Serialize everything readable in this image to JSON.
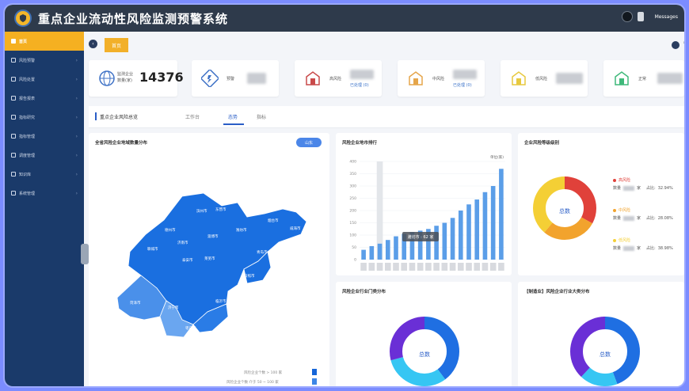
{
  "app": {
    "title": "重点企业流动性风险监测预警系统",
    "messages": "Messages"
  },
  "sidebar": {
    "items": [
      {
        "label": "首页",
        "active": true
      },
      {
        "label": "风险预警"
      },
      {
        "label": "风险处置"
      },
      {
        "label": "报告报表"
      },
      {
        "label": "指标研究"
      },
      {
        "label": "指标管理"
      },
      {
        "label": "调度管理"
      },
      {
        "label": "知识库"
      },
      {
        "label": "系统管理"
      }
    ]
  },
  "tabs": {
    "home_label": "首页"
  },
  "kpis": [
    {
      "label_line1": "监测企业",
      "label_line2": "数量(家)",
      "value": "14376",
      "icon": "globe-icon"
    },
    {
      "label": "预警",
      "icon": "warning-icon"
    },
    {
      "label": "高风险",
      "sub": "已处理 (0)",
      "icon": "house-red-icon",
      "color": "#c94a4a"
    },
    {
      "label": "中风险",
      "sub": "已处理 (0)",
      "icon": "house-orange-icon",
      "color": "#e5a54a"
    },
    {
      "label": "低风险",
      "icon": "house-yellow-icon",
      "color": "#e7c93e"
    },
    {
      "label": "正常",
      "icon": "house-green-icon",
      "color": "#3fb97a"
    }
  ],
  "section": {
    "title": "重点企业风险总览",
    "tabs": [
      "工作台",
      "态势",
      "指标"
    ]
  },
  "map_panel": {
    "title": "全省风险企业地域数量分布",
    "badge": "山东",
    "cities": [
      "聊城市",
      "德州市",
      "滨州市",
      "东营市",
      "烟台市",
      "威海市",
      "潍坊市",
      "淄博市",
      "济南市",
      "泰安市",
      "莱芜市",
      "青岛市",
      "日照市",
      "临沂市",
      "枣庄市",
      "济宁市",
      "菏泽市"
    ],
    "legend": [
      {
        "label": "风险企业个数 > 100 家",
        "color": "#1565d8"
      },
      {
        "label": "风险企业个数 介于 50 ~ 100 家",
        "color": "#3d86e6"
      },
      {
        "label": "风险企业个数 介于 20 ~ 50 家",
        "color": "#6ea6ef"
      }
    ]
  },
  "bar_panel": {
    "title": "风险企业地市排行",
    "unit": "单位(家)",
    "tooltip": "潍坊市 : 62 家"
  },
  "level_panel": {
    "title": "企业风险等级级别",
    "center_label": "总数",
    "items": [
      {
        "label": "高风险",
        "pct": "32.94%",
        "prefix": "数量",
        "suffix": "家",
        "ratio_label": "占比",
        "color": "#e0413a"
      },
      {
        "label": "中风险",
        "pct": "28.08%",
        "prefix": "数量",
        "suffix": "家",
        "ratio_label": "占比",
        "color": "#f2a32d"
      },
      {
        "label": "低风险",
        "pct": "38.98%",
        "prefix": "数量",
        "suffix": "家",
        "ratio_label": "占比",
        "color": "#f4cf35"
      }
    ]
  },
  "industry_panel": {
    "title": "风险企业行业门类分布",
    "center_label": "总数"
  },
  "manufacturing_panel": {
    "title": "【制造业】风险企业行业大类分布",
    "center_label": "总数"
  },
  "chart_data": [
    {
      "type": "bar",
      "title": "风险企业地市排行",
      "ylabel": "单位(家)",
      "ylim": [
        0,
        400
      ],
      "yticks": [
        0,
        50,
        100,
        150,
        200,
        250,
        300,
        350,
        400
      ],
      "values": [
        40,
        55,
        65,
        80,
        95,
        105,
        112,
        118,
        125,
        138,
        150,
        170,
        200,
        225,
        245,
        275,
        300,
        370
      ]
    },
    {
      "type": "pie",
      "title": "企业风险等级级别",
      "labels": [
        "高风险",
        "中风险",
        "低风险"
      ],
      "values": [
        32.94,
        28.08,
        38.98
      ]
    }
  ]
}
